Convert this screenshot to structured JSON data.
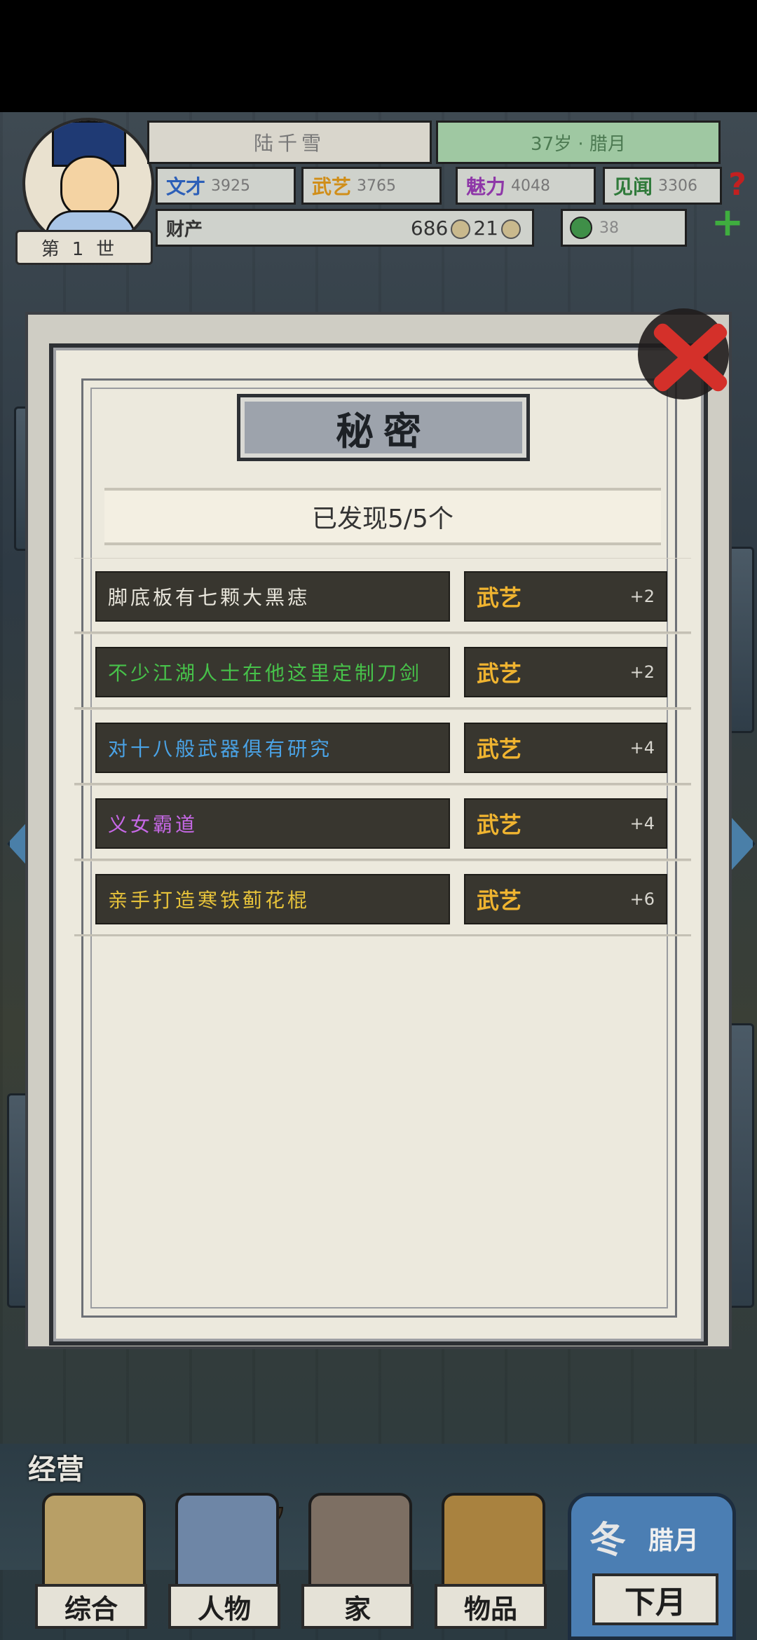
{
  "hud": {
    "name": "陆千雪",
    "age": "37岁 · 腊月",
    "generation": "第1世",
    "stats": [
      {
        "label": "文才",
        "value": "3925",
        "color": "#2c5fb8"
      },
      {
        "label": "武艺",
        "value": "3765",
        "color": "#d08e19"
      },
      {
        "label": "魅力",
        "value": "4048",
        "color": "#8e37a8"
      },
      {
        "label": "见闻",
        "value": "3306",
        "color": "#2f7a3a"
      }
    ],
    "wealth_label": "财产",
    "silver": "686",
    "coins": "21",
    "gems": "38",
    "help_icon": "?",
    "add_icon": "+"
  },
  "modal": {
    "title": "秘密",
    "found_text": "已发现5/5个",
    "secrets": [
      {
        "text": "脚底板有七颗大黑痣",
        "text_color": "#e9e6dc",
        "attr": "武艺",
        "value": "+2"
      },
      {
        "text": "不少江湖人士在他这里定制刀剑",
        "text_color": "#47c24a",
        "attr": "武艺",
        "value": "+2"
      },
      {
        "text": "对十八般武器俱有研究",
        "text_color": "#4aa3e6",
        "attr": "武艺",
        "value": "+4"
      },
      {
        "text": "义女霸道",
        "text_color": "#c668e6",
        "attr": "武艺",
        "value": "+4"
      },
      {
        "text": "亲手打造寒铁蓟花棍",
        "text_color": "#e6c23a",
        "attr": "武艺",
        "value": "+6"
      }
    ]
  },
  "bottom_nav": {
    "business_label": "经营",
    "items": [
      {
        "label": "综合",
        "icon": "scroll-books-icon",
        "color": "#b89f66"
      },
      {
        "label": "人物",
        "icon": "person-icon",
        "color": "#6e86a6"
      },
      {
        "label": "家",
        "icon": "house-icon",
        "color": "#7d6f63"
      },
      {
        "label": "物品",
        "icon": "items-icon",
        "color": "#a9823f"
      }
    ],
    "season": "冬",
    "month": "腊月",
    "next_month": "下月"
  }
}
